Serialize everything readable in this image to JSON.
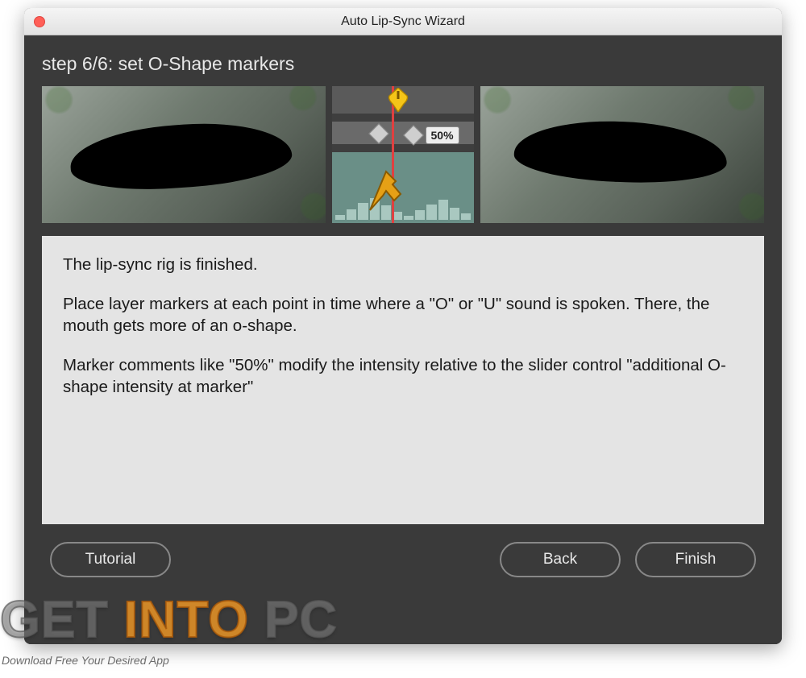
{
  "window": {
    "title": "Auto Lip-Sync Wizard"
  },
  "step": {
    "label": "step 6/6: set O-Shape markers"
  },
  "timeline": {
    "marker_value": "50%"
  },
  "instructions": {
    "p1": "The lip-sync rig is finished.",
    "p2": "Place layer markers at each point in time where a \"O\" or \"U\" sound is spoken. There, the mouth gets more of an o-shape.",
    "p3": "Marker comments like \"50%\" modify the intensity relative to the slider control \"additional O-shape intensity at marker\""
  },
  "buttons": {
    "tutorial": "Tutorial",
    "back": "Back",
    "finish": "Finish"
  },
  "watermark": {
    "get": "GET ",
    "into": "INTO",
    "pc": " PC",
    "tagline": "Download Free Your Desired App"
  }
}
